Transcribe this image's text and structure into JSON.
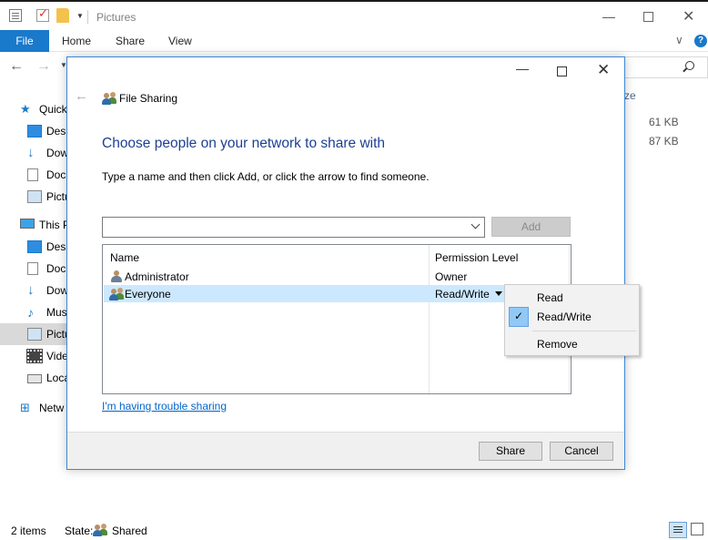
{
  "explorer": {
    "title": "Pictures",
    "ribbon_tabs": {
      "file": "File",
      "home": "Home",
      "share": "Share",
      "view": "View"
    },
    "sidebar": [
      {
        "label": "Quick",
        "icon": "star-icon"
      },
      {
        "label": "Desk",
        "icon": "desktop-icon"
      },
      {
        "label": "Dow",
        "icon": "downloads-icon"
      },
      {
        "label": "Doc",
        "icon": "documents-icon"
      },
      {
        "label": "Pictu",
        "icon": "pictures-icon"
      },
      {
        "label": "This P",
        "icon": "this-pc-icon"
      },
      {
        "label": "Desk",
        "icon": "desktop-icon"
      },
      {
        "label": "Doc",
        "icon": "documents-icon"
      },
      {
        "label": "Dow",
        "icon": "downloads-icon"
      },
      {
        "label": "Mus",
        "icon": "music-icon"
      },
      {
        "label": "Pictu",
        "icon": "pictures-icon"
      },
      {
        "label": "Vide",
        "icon": "videos-icon"
      },
      {
        "label": "Loca",
        "icon": "local-disk-icon"
      },
      {
        "label": "Netw",
        "icon": "network-icon"
      }
    ],
    "column_fragment": "ze",
    "sizes": [
      "61 KB",
      "87 KB"
    ],
    "status": {
      "items": "2 items",
      "state_label": "State:",
      "state_value": "Shared"
    }
  },
  "dialog": {
    "title": "File Sharing",
    "heading": "Choose people on your network to share with",
    "instruction": "Type a name and then click Add, or click the arrow to find someone.",
    "name_input_value": "",
    "add_label": "Add",
    "columns": {
      "name": "Name",
      "permission": "Permission Level"
    },
    "rows": [
      {
        "name": "Administrator",
        "permission": "Owner"
      },
      {
        "name": "Everyone",
        "permission": "Read/Write"
      }
    ],
    "trouble_link": "I'm having trouble sharing",
    "share_label": "Share",
    "cancel_label": "Cancel"
  },
  "context_menu": {
    "items": [
      "Read",
      "Read/Write",
      "Remove"
    ],
    "checked": "Read/Write"
  },
  "colors": {
    "accent": "#1979ca",
    "heading": "#1c3f94",
    "selection": "#cce8ff",
    "link": "#0066cc"
  }
}
